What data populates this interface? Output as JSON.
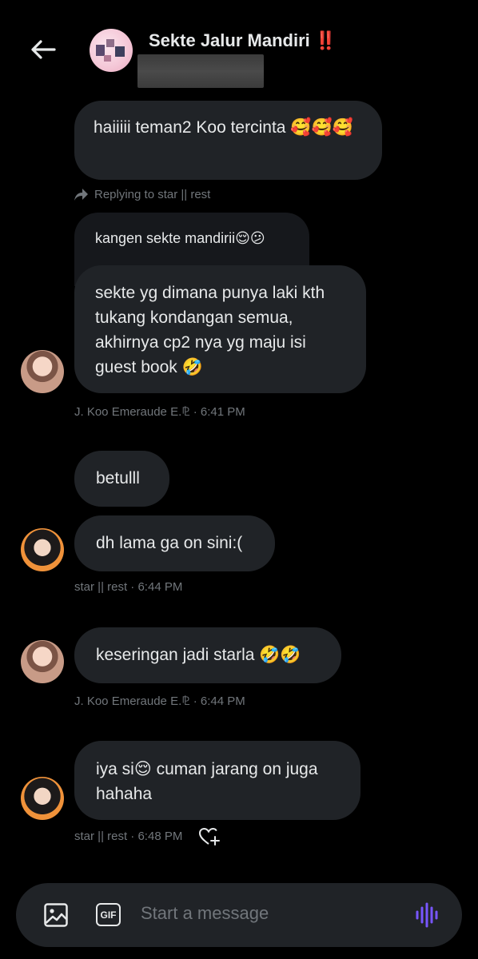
{
  "header": {
    "title": "Sekte Jalur Mandiri",
    "title_emoji": "‼️",
    "back_icon": "arrow-left-icon"
  },
  "messages": {
    "m1": {
      "text": "haiiiii teman2 Koo tercinta 🥰🥰🥰"
    },
    "m2": {
      "reply_context": "Replying to star || rest",
      "quoted_text": "kangen sekte mandirii😌😕",
      "text": "sekte yg dimana punya laki kth tukang kondangan semua, akhirnya cp2 nya yg maju isi guest book 🤣",
      "meta": "J. Koo Emeraude E.⅊ · 6:41 PM"
    },
    "m3": {
      "text": "betulll"
    },
    "m4": {
      "text": "dh lama ga on sini:(",
      "meta": "star || rest · 6:44 PM"
    },
    "m5": {
      "text": "keseringan jadi starla 🤣🤣",
      "meta": "J. Koo Emeraude E.⅊ · 6:44 PM"
    },
    "m6": {
      "text": "iya si😌 cuman jarang on juga hahaha",
      "meta": "star || rest · 6:48 PM"
    }
  },
  "composer": {
    "placeholder": "Start a message",
    "gif_label": "GIF",
    "icons": [
      "image-icon",
      "gif-icon",
      "voice-icon"
    ]
  },
  "colors": {
    "background": "#000000",
    "bubble": "#202327",
    "meta_text": "#71767b",
    "voice_accent": "#7856ff"
  }
}
